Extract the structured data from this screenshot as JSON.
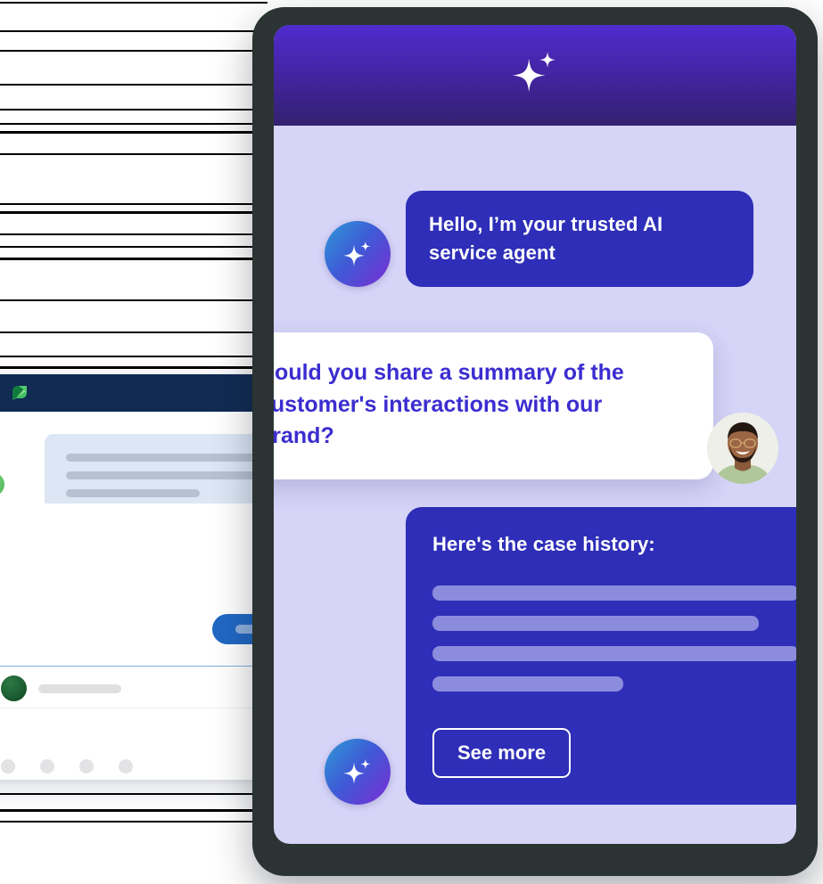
{
  "background": {
    "rule_lines": [
      2,
      34,
      56,
      94,
      122,
      138,
      147,
      172,
      228,
      237,
      262,
      276,
      289,
      336,
      372,
      399,
      411,
      890,
      908,
      921
    ]
  },
  "left_window": {
    "logo_icon": "sprout-leaf-logo",
    "header_color": "#112B53",
    "message_card": {
      "bars": [
        272,
        272,
        150
      ]
    },
    "status_dot_color": "#4CB457",
    "primary_button_color": "#2168C4",
    "compose": {
      "avatar_color": "#10401F",
      "action_dots": 4
    }
  },
  "tablet": {
    "bezel_color": "#2B3433",
    "screen_bg": "#D6D4F7",
    "header": {
      "icon": "sparkle-icon",
      "gradient_from": "#4F2CCF",
      "gradient_to": "#33216F"
    }
  },
  "chat": {
    "bubble_color": "#2E2EB8",
    "user_text_color": "#3B2DD0",
    "messages": [
      {
        "id": "greeting",
        "sender": "ai",
        "avatar_icon": "ai-sparkle-avatar",
        "text": "Hello, I’m your trusted AI service agent"
      },
      {
        "id": "user-question",
        "sender": "user",
        "avatar_icon": "user-photo-avatar",
        "text": "Could you share a summary of the customer's interactions with our brand?"
      },
      {
        "id": "case-history",
        "sender": "ai",
        "avatar_icon": "ai-sparkle-avatar",
        "title": "Here's the case history:",
        "skeleton_widths": [
          "100%",
          "89%",
          "100%",
          "52%"
        ],
        "action_label": "See more"
      }
    ]
  }
}
